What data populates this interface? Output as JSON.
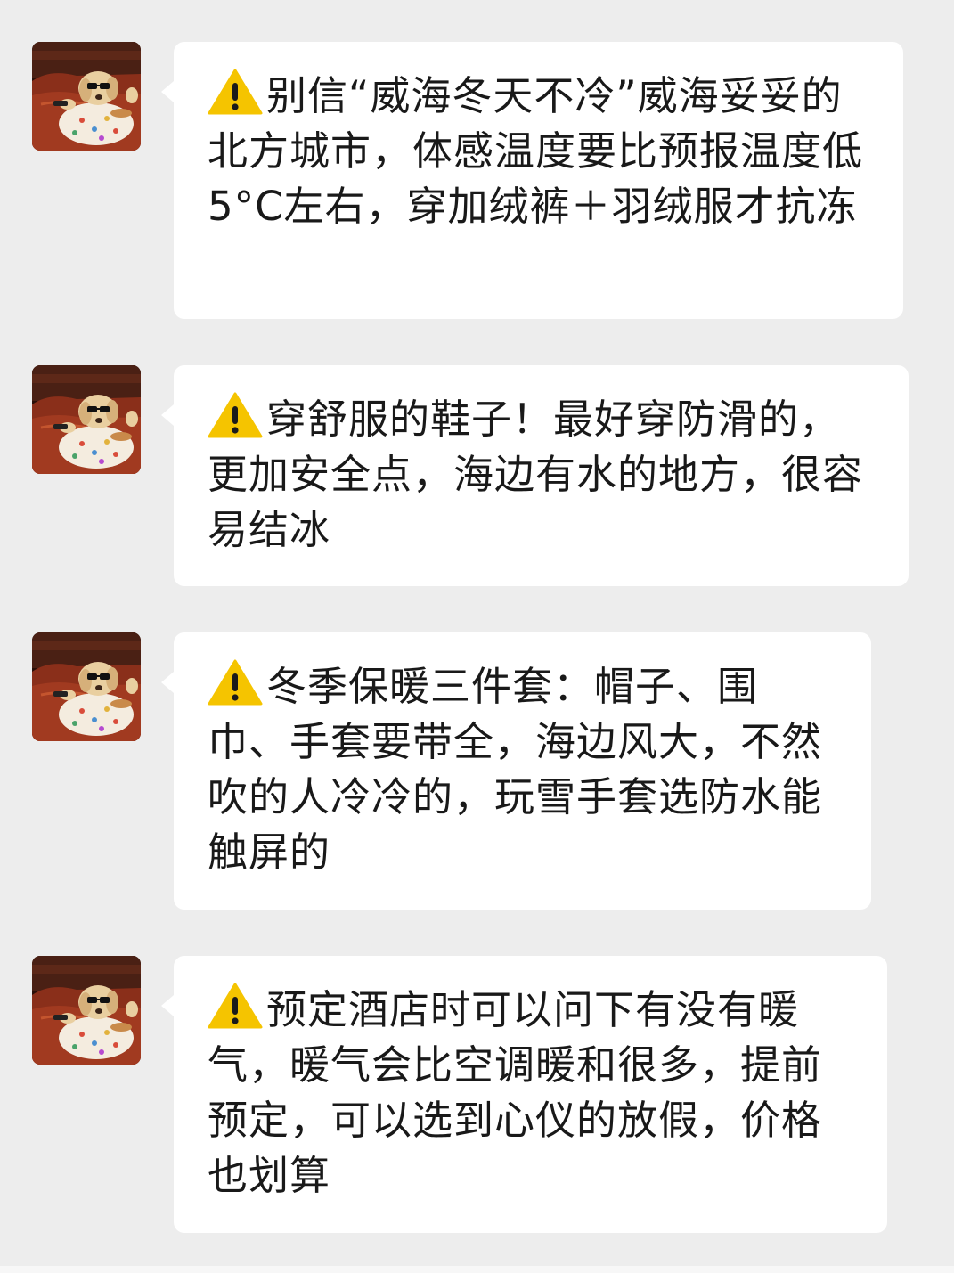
{
  "messages": [
    {
      "icon": "warning-icon",
      "text": "别信“威海冬天不冷”威海妥妥的北方城市，体感温度要比预报温度低 5°C左右，穿加绒裤＋羽绒服才抗冻"
    },
    {
      "icon": "warning-icon",
      "text": "穿舒服的鞋子！最好穿防滑的，更加安全点，海边有水的地方，很容易结冰"
    },
    {
      "icon": "warning-icon",
      "text": "冬季保暖三件套：帽子、围巾、手套要带全，海边风大，不然吹的人冷冷的，玩雪手套选防水能触屏的"
    },
    {
      "icon": "warning-icon",
      "text": "预定酒店时可以问下有没有暖气，暖气会比空调暖和很多，提前预定，可以选到心仪的放假，价格也划算"
    }
  ],
  "colors": {
    "background": "#ededed",
    "bubble": "#ffffff",
    "text": "#191919",
    "warning": "#f5c400"
  }
}
